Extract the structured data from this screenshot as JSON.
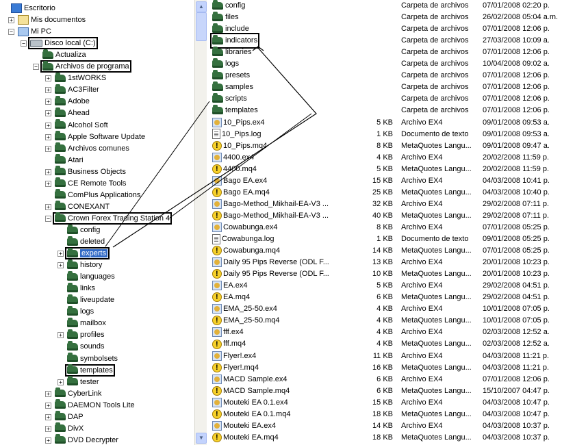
{
  "tree": {
    "items": [
      {
        "label": "Escritorio",
        "icon": "desktop-icon"
      },
      {
        "label": "Mis documentos",
        "icon": "my-documents-icon",
        "expander": "+"
      },
      {
        "label": "Mi PC",
        "icon": "my-computer-icon",
        "expander": "−"
      },
      {
        "label": "Disco local (C:)",
        "icon": "drive-icon",
        "expander": "−",
        "boxed": true
      },
      {
        "label": "Actualiza",
        "icon": "folder-icon"
      },
      {
        "label": "Archivos de programa",
        "icon": "folder-icon",
        "expander": "−",
        "boxed": true
      },
      {
        "label": "1stWORKS",
        "icon": "folder-icon",
        "expander": "+"
      },
      {
        "label": "AC3Filter",
        "icon": "folder-icon",
        "expander": "+"
      },
      {
        "label": "Adobe",
        "icon": "folder-icon",
        "expander": "+"
      },
      {
        "label": "Ahead",
        "icon": "folder-icon",
        "expander": "+"
      },
      {
        "label": "Alcohol Soft",
        "icon": "folder-icon",
        "expander": "+"
      },
      {
        "label": "Apple Software Update",
        "icon": "folder-icon",
        "expander": "+"
      },
      {
        "label": "Archivos comunes",
        "icon": "folder-icon",
        "expander": "+"
      },
      {
        "label": "Atari",
        "icon": "folder-icon"
      },
      {
        "label": "Business Objects",
        "icon": "folder-icon",
        "expander": "+"
      },
      {
        "label": "CE Remote Tools",
        "icon": "folder-icon",
        "expander": "+"
      },
      {
        "label": "ComPlus Applications",
        "icon": "folder-icon"
      },
      {
        "label": "CONEXANT",
        "icon": "folder-icon",
        "expander": "+"
      },
      {
        "label": "Crown Forex Trading Station 4",
        "icon": "folder-icon",
        "expander": "−",
        "boxed": true
      },
      {
        "label": "config",
        "icon": "folder-icon"
      },
      {
        "label": "deleted",
        "icon": "folder-icon"
      },
      {
        "label": "experts",
        "icon": "folder-icon",
        "expander": "+",
        "boxed": true,
        "selected": true
      },
      {
        "label": "history",
        "icon": "folder-icon",
        "expander": "+"
      },
      {
        "label": "languages",
        "icon": "folder-icon"
      },
      {
        "label": "links",
        "icon": "folder-icon"
      },
      {
        "label": "liveupdate",
        "icon": "folder-icon"
      },
      {
        "label": "logs",
        "icon": "folder-icon"
      },
      {
        "label": "mailbox",
        "icon": "folder-icon"
      },
      {
        "label": "profiles",
        "icon": "folder-icon",
        "expander": "+"
      },
      {
        "label": "sounds",
        "icon": "folder-icon"
      },
      {
        "label": "symbolsets",
        "icon": "folder-icon"
      },
      {
        "label": "templates",
        "icon": "folder-icon",
        "boxed": true
      },
      {
        "label": "tester",
        "icon": "folder-icon",
        "expander": "+"
      },
      {
        "label": "CyberLink",
        "icon": "folder-icon",
        "expander": "+"
      },
      {
        "label": "DAEMON Tools Lite",
        "icon": "folder-icon",
        "expander": "+"
      },
      {
        "label": "DAP",
        "icon": "folder-icon",
        "expander": "+"
      },
      {
        "label": "DivX",
        "icon": "folder-icon",
        "expander": "+"
      },
      {
        "label": "DVD Decrypter",
        "icon": "folder-icon",
        "expander": "+"
      }
    ]
  },
  "scrollbar": {
    "up": "▲",
    "down": "▼"
  },
  "files": [
    {
      "name": "config",
      "size": "",
      "type": "Carpeta de archivos",
      "date": "07/01/2008 02:20 p.",
      "icon": "folder"
    },
    {
      "name": "files",
      "size": "",
      "type": "Carpeta de archivos",
      "date": "26/02/2008 05:04 a.m.",
      "icon": "folder"
    },
    {
      "name": "include",
      "size": "",
      "type": "Carpeta de archivos",
      "date": "07/01/2008 12:06 p.",
      "icon": "folder"
    },
    {
      "name": "indicators",
      "size": "",
      "type": "Carpeta de archivos",
      "date": "27/03/2008 10:09 a.",
      "icon": "folder",
      "boxed": true
    },
    {
      "name": "libraries",
      "size": "",
      "type": "Carpeta de archivos",
      "date": "07/01/2008 12:06 p.",
      "icon": "folder"
    },
    {
      "name": "logs",
      "size": "",
      "type": "Carpeta de archivos",
      "date": "10/04/2008 09:02 a.",
      "icon": "folder"
    },
    {
      "name": "presets",
      "size": "",
      "type": "Carpeta de archivos",
      "date": "07/01/2008 12:06 p.",
      "icon": "folder"
    },
    {
      "name": "samples",
      "size": "",
      "type": "Carpeta de archivos",
      "date": "07/01/2008 12:06 p.",
      "icon": "folder"
    },
    {
      "name": "scripts",
      "size": "",
      "type": "Carpeta de archivos",
      "date": "07/01/2008 12:06 p.",
      "icon": "folder"
    },
    {
      "name": "templates",
      "size": "",
      "type": "Carpeta de archivos",
      "date": "07/01/2008 12:06 p.",
      "icon": "folder"
    },
    {
      "name": "10_Pips.ex4",
      "size": "5 KB",
      "type": "Archivo EX4",
      "date": "09/01/2008 09:53 a.",
      "icon": "ex4"
    },
    {
      "name": "10_Pips.log",
      "size": "1 KB",
      "type": "Documento de texto",
      "date": "09/01/2008 09:53 a.",
      "icon": "log"
    },
    {
      "name": "10_Pips.mq4",
      "size": "8 KB",
      "type": "MetaQuotes Langu...",
      "date": "09/01/2008 09:47 a.",
      "icon": "mq4"
    },
    {
      "name": "4400.ex4",
      "size": "4 KB",
      "type": "Archivo EX4",
      "date": "20/02/2008 11:59 p.",
      "icon": "ex4"
    },
    {
      "name": "4400.mq4",
      "size": "5 KB",
      "type": "MetaQuotes Langu...",
      "date": "20/02/2008 11:59 p.",
      "icon": "mq4"
    },
    {
      "name": "Bago EA.ex4",
      "size": "15 KB",
      "type": "Archivo EX4",
      "date": "04/03/2008 10:41 p.",
      "icon": "ex4"
    },
    {
      "name": "Bago EA.mq4",
      "size": "25 KB",
      "type": "MetaQuotes Langu...",
      "date": "04/03/2008 10:40 p.",
      "icon": "mq4"
    },
    {
      "name": "Bago-Method_Mikhail-EA-V3 ...",
      "size": "32 KB",
      "type": "Archivo EX4",
      "date": "29/02/2008 07:11 p.",
      "icon": "ex4"
    },
    {
      "name": "Bago-Method_Mikhail-EA-V3 ...",
      "size": "40 KB",
      "type": "MetaQuotes Langu...",
      "date": "29/02/2008 07:11 p.",
      "icon": "mq4"
    },
    {
      "name": "Cowabunga.ex4",
      "size": "8 KB",
      "type": "Archivo EX4",
      "date": "07/01/2008 05:25 p.",
      "icon": "ex4"
    },
    {
      "name": "Cowabunga.log",
      "size": "1 KB",
      "type": "Documento de texto",
      "date": "09/01/2008 05:25 p.",
      "icon": "log"
    },
    {
      "name": "Cowabunga.mq4",
      "size": "14 KB",
      "type": "MetaQuotes Langu...",
      "date": "07/01/2008 05:25 p.",
      "icon": "mq4"
    },
    {
      "name": "Daily 95 Pips Reverse (ODL F...",
      "size": "13 KB",
      "type": "Archivo EX4",
      "date": "20/01/2008 10:23 p.",
      "icon": "ex4"
    },
    {
      "name": "Daily 95 Pips Reverse (ODL F...",
      "size": "10 KB",
      "type": "MetaQuotes Langu...",
      "date": "20/01/2008 10:23 p.",
      "icon": "mq4"
    },
    {
      "name": "EA.ex4",
      "size": "5 KB",
      "type": "Archivo EX4",
      "date": "29/02/2008 04:51 p.",
      "icon": "ex4"
    },
    {
      "name": "EA.mq4",
      "size": "6 KB",
      "type": "MetaQuotes Langu...",
      "date": "29/02/2008 04:51 p.",
      "icon": "mq4"
    },
    {
      "name": "EMA_25-50.ex4",
      "size": "4 KB",
      "type": "Archivo EX4",
      "date": "10/01/2008 07:05 p.",
      "icon": "ex4"
    },
    {
      "name": "EMA_25-50.mq4",
      "size": "4 KB",
      "type": "MetaQuotes Langu...",
      "date": "10/01/2008 07:05 p.",
      "icon": "mq4"
    },
    {
      "name": "fff.ex4",
      "size": "4 KB",
      "type": "Archivo EX4",
      "date": "02/03/2008 12:52 a.",
      "icon": "ex4"
    },
    {
      "name": "fff.mq4",
      "size": "4 KB",
      "type": "MetaQuotes Langu...",
      "date": "02/03/2008 12:52 a.",
      "icon": "mq4"
    },
    {
      "name": "Flyer!.ex4",
      "size": "11 KB",
      "type": "Archivo EX4",
      "date": "04/03/2008 11:21 p.",
      "icon": "ex4"
    },
    {
      "name": "Flyer!.mq4",
      "size": "16 KB",
      "type": "MetaQuotes Langu...",
      "date": "04/03/2008 11:21 p.",
      "icon": "mq4"
    },
    {
      "name": "MACD Sample.ex4",
      "size": "6 KB",
      "type": "Archivo EX4",
      "date": "07/01/2008 12:06 p.",
      "icon": "ex4"
    },
    {
      "name": "MACD Sample.mq4",
      "size": "6 KB",
      "type": "MetaQuotes Langu...",
      "date": "15/10/2007 04:47 p.",
      "icon": "mq4"
    },
    {
      "name": "Mouteki EA 0.1.ex4",
      "size": "15 KB",
      "type": "Archivo EX4",
      "date": "04/03/2008 10:47 p.",
      "icon": "ex4"
    },
    {
      "name": "Mouteki EA 0.1.mq4",
      "size": "18 KB",
      "type": "MetaQuotes Langu...",
      "date": "04/03/2008 10:47 p.",
      "icon": "mq4"
    },
    {
      "name": "Mouteki EA.ex4",
      "size": "14 KB",
      "type": "Archivo EX4",
      "date": "04/03/2008 10:37 p.",
      "icon": "ex4"
    },
    {
      "name": "Mouteki EA.mq4",
      "size": "18 KB",
      "type": "MetaQuotes Langu...",
      "date": "04/03/2008 10:37 p.",
      "icon": "mq4"
    }
  ]
}
